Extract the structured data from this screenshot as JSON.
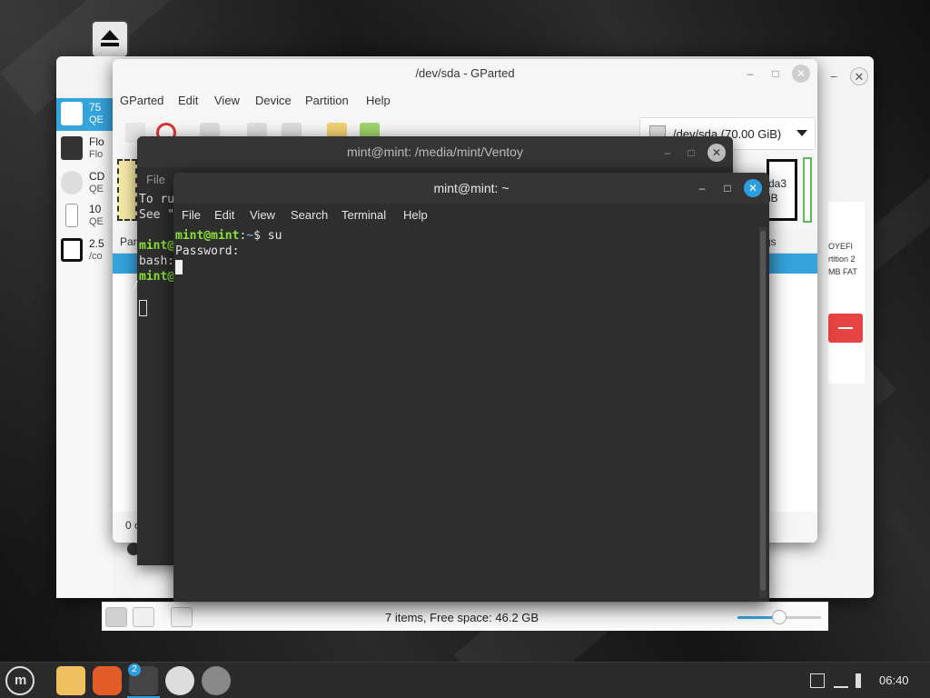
{
  "nemo": {
    "sidebar": [
      {
        "l1": "75",
        "l2": "QE",
        "selected": true
      },
      {
        "l1": "Flo",
        "l2": "Flo",
        "selected": false
      },
      {
        "l1": "CD",
        "l2": "QE",
        "selected": false
      },
      {
        "l1": "10",
        "l2": "QE",
        "selected": false
      },
      {
        "l1": "2.5",
        "l2": "/co",
        "selected": false
      }
    ],
    "right_texts": [
      "OYEFI",
      "rtition 2",
      "MB FAT"
    ],
    "status_text": "7 items, Free space: 46.2 GB",
    "zoom_level": 0.5
  },
  "gparted": {
    "title": "/dev/sda - GParted",
    "menu": [
      "GParted",
      "Edit",
      "View",
      "Device",
      "Partition",
      "Help"
    ],
    "device": "/dev/sda  (70.00 GiB)",
    "disk_texts": [
      "da3",
      "iB"
    ],
    "table_headers": [
      "Par",
      "gs"
    ],
    "footer": "0 c"
  },
  "terminal_ventoy": {
    "title": "mint@mint: /media/mint/Ventoy",
    "menu": "File",
    "lines": {
      "l1": "To ru",
      "l2": "See \"",
      "l3_prompt": "mint@",
      "l4": "bash:",
      "l5_prompt": "mint@",
      "l6": "/"
    }
  },
  "terminal": {
    "title": "mint@mint: ~",
    "menu": [
      "File",
      "Edit",
      "View",
      "Search",
      "Terminal",
      "Help"
    ],
    "line1": {
      "user": "mint@mint",
      "sep": ":",
      "path": "~",
      "cmd": "$ su"
    },
    "line2": "Password:"
  },
  "taskbar": {
    "terminal_badge": "2",
    "clock": "06:40"
  },
  "colors": {
    "accent": "#35a3dc",
    "close_button": "#2c9fe0",
    "prompt_green": "#8ae234",
    "prompt_blue": "#729fcf",
    "delete_red": "#e64343"
  }
}
